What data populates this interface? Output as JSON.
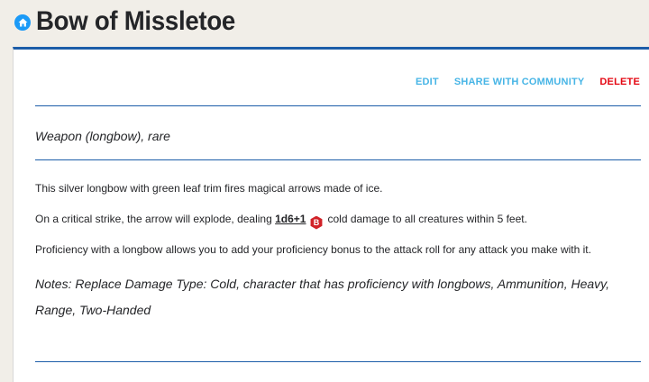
{
  "page": {
    "title": "Bow of Missletoe",
    "home_icon": "home-icon"
  },
  "actions": {
    "edit": "EDIT",
    "share": "SHARE WITH COMMUNITY",
    "delete": "DELETE"
  },
  "item": {
    "subtitle": "Weapon (longbow), rare",
    "description_1": "This silver longbow with green leaf trim fires magical arrows made of ice.",
    "description_2_before": "On a critical strike, the arrow will explode, dealing",
    "dice": "1d6+1",
    "dice_icon_label": "B",
    "description_2_after": "cold damage to all creatures within 5 feet.",
    "description_3": "Proficiency with a longbow allows you to add your proficiency bonus to the attack roll for any attack you make with it.",
    "notes": "Notes: Replace Damage Type: Cold, character that has proficiency with longbows, Ammunition, Heavy, Range, Two-Handed"
  },
  "colors": {
    "accent_blue": "#1c5da8",
    "link_blue": "#47b5e6",
    "delete_red": "#e40712",
    "dice_red": "#d12228"
  }
}
